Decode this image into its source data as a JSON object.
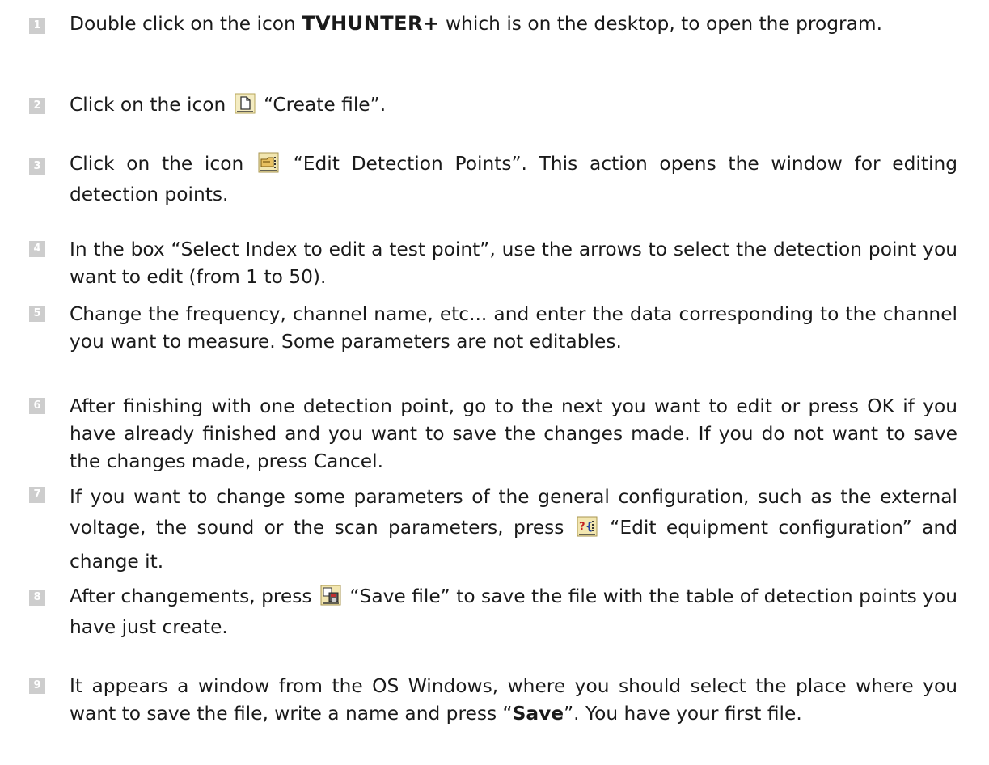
{
  "steps": [
    {
      "num": "1",
      "a": "Double click on the icon ",
      "brand": "TVHUNTER+",
      "b": " which is on the desktop, to open the program."
    },
    {
      "num": "2",
      "a": "Click on the icon ",
      "b": " “Create file”."
    },
    {
      "num": "3",
      "a": "Click on the icon ",
      "b": " “Edit Detection Points”. This action opens the window for editing detection points."
    },
    {
      "num": "4",
      "text": "In the box “Select Index to edit a test point”, use the arrows to select the detection point you want to edit (from 1 to 50)."
    },
    {
      "num": "5",
      "text": "Change the frequency, channel name, etc... and enter the data corresponding to the channel you want to measure. Some parameters are not editables."
    },
    {
      "num": "6",
      "text": "After finishing with one detection point, go to the next you want to edit or press OK if you have already finished and you want to save the changes made. If you do not want to save the changes made, press Cancel."
    },
    {
      "num": "7",
      "a": "If you want to change some parameters of the general configuration, such as the external voltage, the sound or the scan parameters, press ",
      "b": " “Edit equipment configuration” and change it."
    },
    {
      "num": "8",
      "a": "After changements, press ",
      "b": " “Save file” to save the file with the table of detection points you have just create."
    },
    {
      "num": "9",
      "a": "It appears a window from the OS Windows, where you should select the place where you want to save the file, write a name and press “",
      "bold": "Save",
      "b": "”. You have your first file."
    }
  ],
  "icons": {
    "step2": "create-file-icon",
    "step3": "edit-detection-points-icon",
    "step7": "edit-equipment-configuration-icon",
    "step8": "save-file-icon"
  }
}
